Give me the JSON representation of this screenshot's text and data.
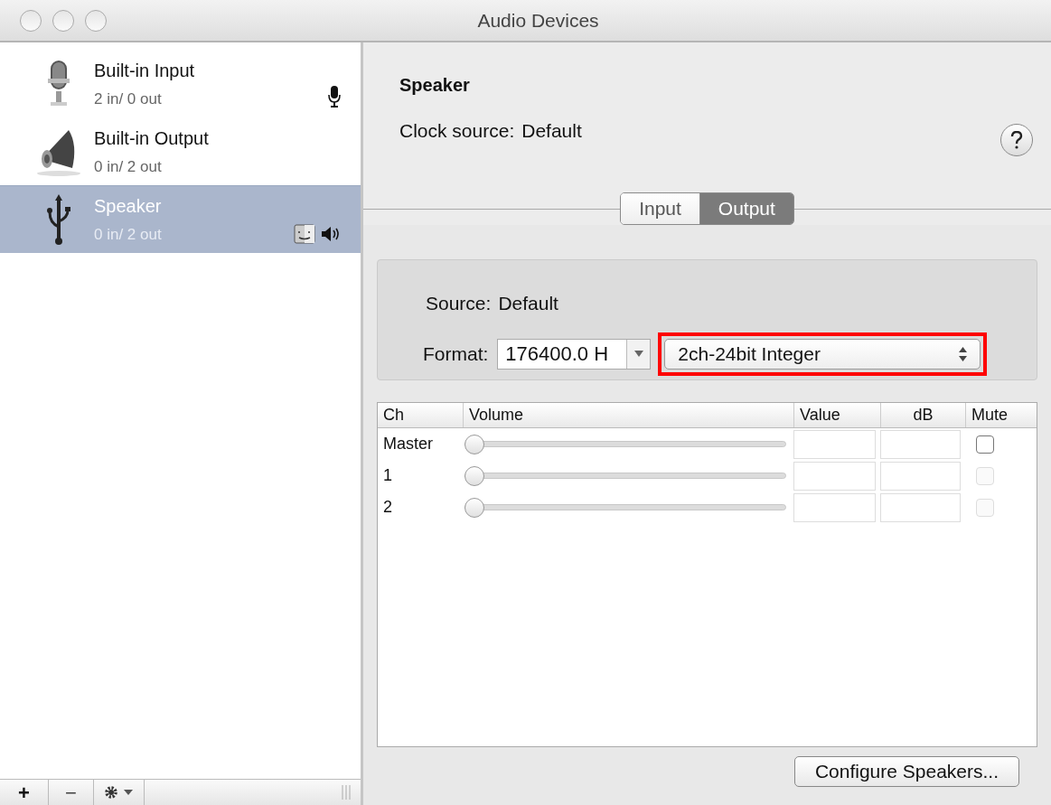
{
  "window": {
    "title": "Audio Devices"
  },
  "devices": [
    {
      "kind": "microphone",
      "name": "Built-in Input",
      "channels": "2 in/ 0 out",
      "selected": false,
      "badges": [
        {
          "kind": "microphone"
        }
      ]
    },
    {
      "kind": "speaker",
      "name": "Built-in Output",
      "channels": "0 in/ 2 out",
      "selected": false
    },
    {
      "kind": "usb",
      "name": "Speaker",
      "channels": "0 in/ 2 out",
      "selected": true,
      "badges": [
        {
          "kind": "finder"
        },
        {
          "kind": "speaker"
        }
      ]
    }
  ],
  "sidebar_toolbar": {
    "add": "+",
    "remove": "−"
  },
  "detail": {
    "title": "Speaker",
    "clock_source_label": "Clock source:",
    "clock_source": "Default"
  },
  "tabs": [
    {
      "label": "Input",
      "selected": false
    },
    {
      "label": "Output",
      "selected": true
    }
  ],
  "source": {
    "label": "Source:",
    "value": "Default"
  },
  "format": {
    "label": "Format:",
    "rate": "176400.0 H",
    "bits": "2ch-24bit Integer",
    "highlighted": true
  },
  "table": {
    "columns": [
      "Ch",
      "Volume",
      "Value",
      "dB",
      "Mute"
    ],
    "rows": [
      {
        "channel": "Master",
        "level": 0,
        "muted": false,
        "disabled": false
      },
      {
        "channel": "1",
        "level": 0,
        "muted": false,
        "disabled": true
      },
      {
        "channel": "2",
        "level": 0,
        "muted": false,
        "disabled": true
      }
    ]
  },
  "buttons": [
    "Configure Speakers..."
  ]
}
